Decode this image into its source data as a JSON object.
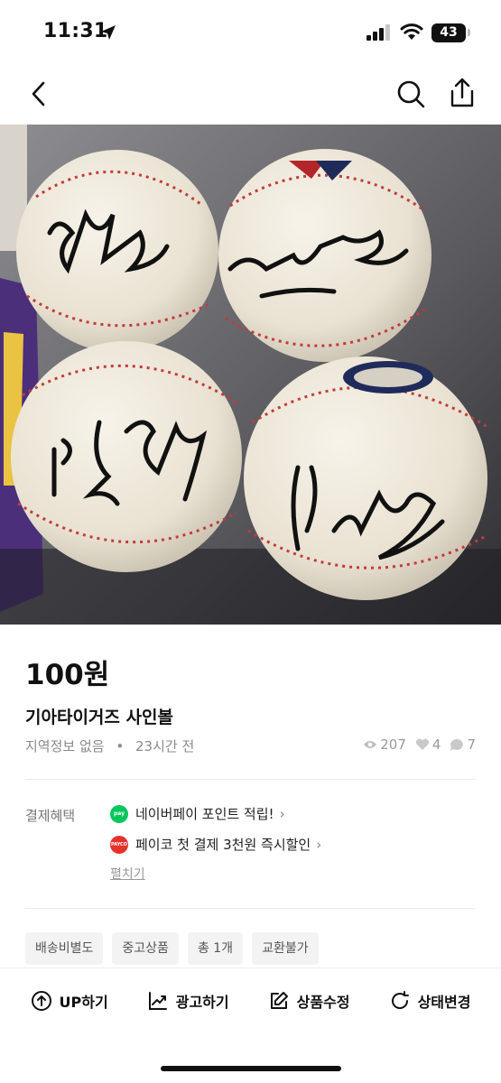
{
  "status": {
    "time": "11:31",
    "battery": "43"
  },
  "product": {
    "price": "100원",
    "title": "기아타이거즈 사인볼",
    "location": "지역정보 없음",
    "separator": "•",
    "posted": "23시간 전",
    "views": "207",
    "likes": "4",
    "chats": "7"
  },
  "payment": {
    "label": "결제혜택",
    "benefits": [
      {
        "logo_text": "pay",
        "logo_color": "#03c75a",
        "text": "네이버페이 포인트 적립!"
      },
      {
        "logo_text": "PAYCO",
        "logo_color": "#e5322d",
        "text": "페이코 첫 결제 3천원 즉시할인"
      }
    ],
    "expand": "펼치기"
  },
  "tags": [
    "배송비별도",
    "중고상품",
    "총 1개",
    "교환불가"
  ],
  "actions": [
    {
      "label": "UP하기",
      "icon": "arrow-up-circle-icon"
    },
    {
      "label": "광고하기",
      "icon": "chart-line-icon"
    },
    {
      "label": "상품수정",
      "icon": "edit-icon"
    },
    {
      "label": "상태변경",
      "icon": "refresh-icon"
    }
  ]
}
